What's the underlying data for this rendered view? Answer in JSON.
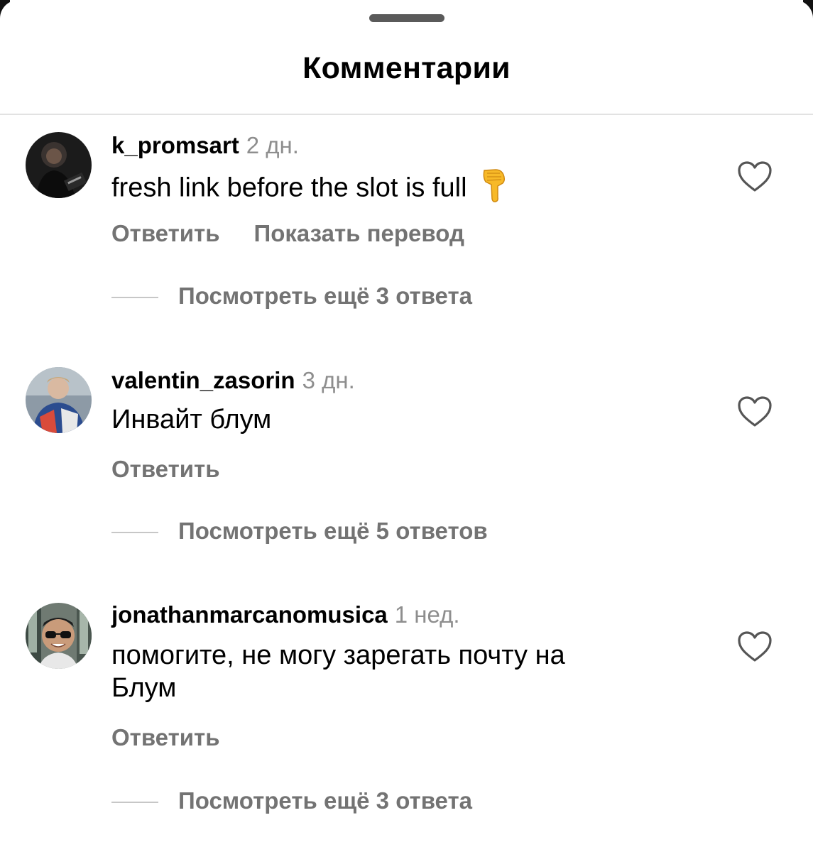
{
  "header": {
    "title": "Комментарии"
  },
  "comments": [
    {
      "username": "k_promsart",
      "time": "2 дн.",
      "text": "fresh link before the slot is full",
      "emoji_icon": "backhand-index-pointing-down",
      "actions": [
        "Ответить",
        "Показать перевод"
      ],
      "replies_label": "Посмотреть ещё 3 ответа"
    },
    {
      "username": "valentin_zasorin",
      "time": "3 дн.",
      "text": "Инвайт блум",
      "actions": [
        "Ответить"
      ],
      "replies_label": "Посмотреть ещё 5 ответов"
    },
    {
      "username": "jonathanmarcanomusica",
      "time": "1 нед.",
      "text_lines": [
        "помогите, не могу зарегать почту на",
        "Блум"
      ],
      "actions": [
        "Ответить"
      ],
      "replies_label": "Посмотреть ещё 3 ответа"
    }
  ],
  "icons": {
    "like": "heart-outline-icon"
  },
  "colors": {
    "secondary_text": "#737373",
    "timestamp": "#8e8e8e",
    "divider": "#e2e2e2"
  }
}
